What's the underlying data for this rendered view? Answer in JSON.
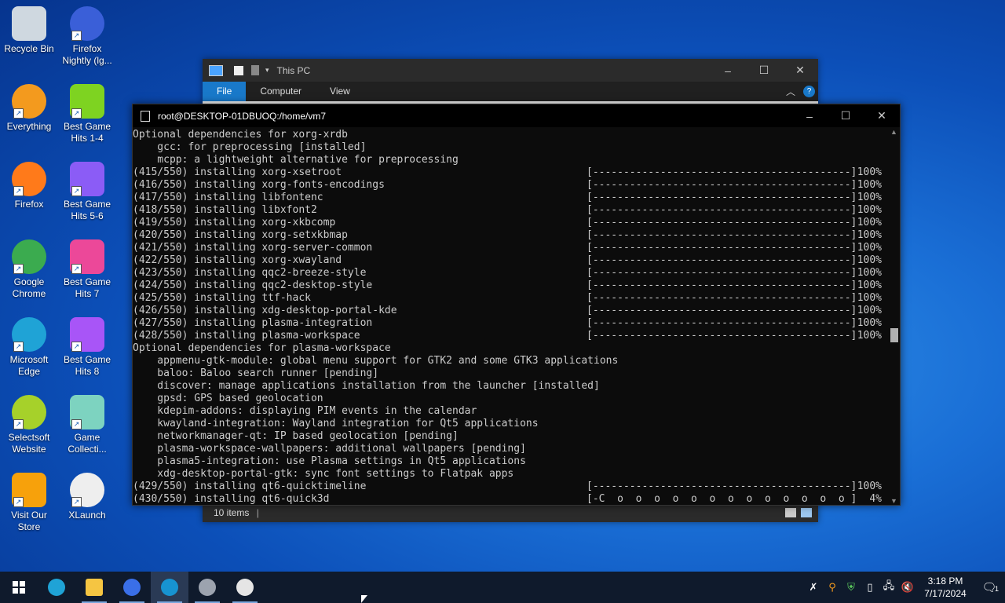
{
  "desktop_icons": [
    {
      "label": "Recycle Bin",
      "icon": "recycle-bin-icon"
    },
    {
      "label": "Firefox Nightly (lg...",
      "icon": "firefox-nightly-icon"
    },
    {
      "label": "Everything",
      "icon": "everything-search-icon"
    },
    {
      "label": "Best Game Hits 1-4",
      "icon": "dice-icon"
    },
    {
      "label": "Firefox",
      "icon": "firefox-icon"
    },
    {
      "label": "Best Game Hits 5-6",
      "icon": "dice-icon"
    },
    {
      "label": "Google Chrome",
      "icon": "chrome-icon"
    },
    {
      "label": "Best Game Hits 7",
      "icon": "dice-icon"
    },
    {
      "label": "Microsoft Edge",
      "icon": "edge-icon"
    },
    {
      "label": "Best Game Hits 8",
      "icon": "dice-icon"
    },
    {
      "label": "Selectsoft Website",
      "icon": "selectsoft-icon"
    },
    {
      "label": "Game Collecti...",
      "icon": "dice-icon"
    },
    {
      "label": "Visit Our Store",
      "icon": "store-icon"
    },
    {
      "label": "XLaunch",
      "icon": "xlaunch-icon"
    }
  ],
  "explorer": {
    "title": "This PC",
    "tabs": [
      "File",
      "Computer",
      "View"
    ],
    "status": "10 items"
  },
  "terminal": {
    "title": "root@DESKTOP-01DBUOQ:/home/vm7",
    "lines": [
      {
        "t": "Optional dependencies for xorg-xrdb"
      },
      {
        "t": "    gcc: for preprocessing [installed]"
      },
      {
        "t": "    mcpp: a lightweight alternative for preprocessing"
      },
      {
        "p": "(415/550) installing xorg-xsetroot",
        "b": "[------------------------------------------]",
        "c": "100%"
      },
      {
        "p": "(416/550) installing xorg-fonts-encodings",
        "b": "[------------------------------------------]",
        "c": "100%"
      },
      {
        "p": "(417/550) installing libfontenc",
        "b": "[------------------------------------------]",
        "c": "100%"
      },
      {
        "p": "(418/550) installing libxfont2",
        "b": "[------------------------------------------]",
        "c": "100%"
      },
      {
        "p": "(419/550) installing xorg-xkbcomp",
        "b": "[------------------------------------------]",
        "c": "100%"
      },
      {
        "p": "(420/550) installing xorg-setxkbmap",
        "b": "[------------------------------------------]",
        "c": "100%"
      },
      {
        "p": "(421/550) installing xorg-server-common",
        "b": "[------------------------------------------]",
        "c": "100%"
      },
      {
        "p": "(422/550) installing xorg-xwayland",
        "b": "[------------------------------------------]",
        "c": "100%"
      },
      {
        "p": "(423/550) installing qqc2-breeze-style",
        "b": "[------------------------------------------]",
        "c": "100%"
      },
      {
        "p": "(424/550) installing qqc2-desktop-style",
        "b": "[------------------------------------------]",
        "c": "100%"
      },
      {
        "p": "(425/550) installing ttf-hack",
        "b": "[------------------------------------------]",
        "c": "100%"
      },
      {
        "p": "(426/550) installing xdg-desktop-portal-kde",
        "b": "[------------------------------------------]",
        "c": "100%"
      },
      {
        "p": "(427/550) installing plasma-integration",
        "b": "[------------------------------------------]",
        "c": "100%"
      },
      {
        "p": "(428/550) installing plasma-workspace",
        "b": "[------------------------------------------]",
        "c": "100%"
      },
      {
        "t": "Optional dependencies for plasma-workspace"
      },
      {
        "t": "    appmenu-gtk-module: global menu support for GTK2 and some GTK3 applications"
      },
      {
        "t": "    baloo: Baloo search runner [pending]"
      },
      {
        "t": "    discover: manage applications installation from the launcher [installed]"
      },
      {
        "t": "    gpsd: GPS based geolocation"
      },
      {
        "t": "    kdepim-addons: displaying PIM events in the calendar"
      },
      {
        "t": "    kwayland-integration: Wayland integration for Qt5 applications"
      },
      {
        "t": "    networkmanager-qt: IP based geolocation [pending]"
      },
      {
        "t": "    plasma-workspace-wallpapers: additional wallpapers [pending]"
      },
      {
        "t": "    plasma5-integration: use Plasma settings in Qt5 applications"
      },
      {
        "t": "    xdg-desktop-portal-gtk: sync font settings to Flatpak apps"
      },
      {
        "p": "(429/550) installing qt6-quicktimeline",
        "b": "[------------------------------------------]",
        "c": "100%"
      },
      {
        "p": "(430/550) installing qt6-quick3d",
        "b": "[-C  o  o  o  o  o  o  o  o  o  o  o  o  o ]",
        "c": "4%"
      }
    ]
  },
  "taskbar": {
    "apps": [
      {
        "icon": "windows-start-icon",
        "name": "start-button"
      },
      {
        "icon": "edge-icon",
        "name": "taskbar-edge"
      },
      {
        "icon": "file-explorer-icon",
        "name": "taskbar-file-explorer"
      },
      {
        "icon": "firefox-nightly-icon",
        "name": "taskbar-firefox-nightly"
      },
      {
        "icon": "arch-terminal-icon",
        "name": "taskbar-terminal"
      },
      {
        "icon": "installer-icon",
        "name": "taskbar-installer"
      },
      {
        "icon": "xlaunch-icon",
        "name": "taskbar-xlaunch"
      }
    ],
    "time": "3:18 PM",
    "date": "7/17/2024",
    "notifications": "1"
  }
}
